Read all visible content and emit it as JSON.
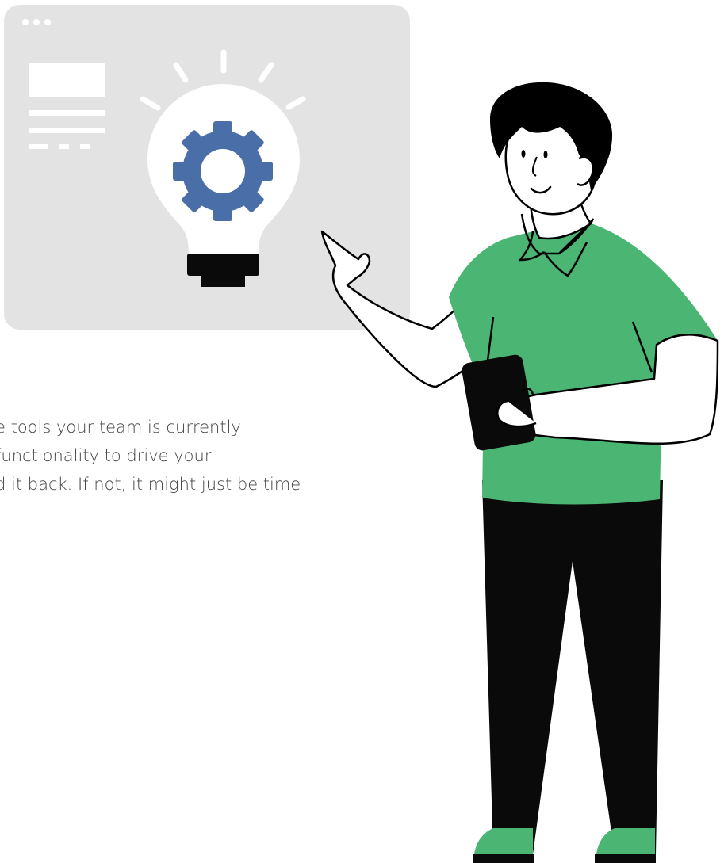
{
  "paragraph": {
    "lines": [
      "e tools your team is currently",
      "functionality to drive your",
      "d it back. If not, it might just be time"
    ]
  },
  "colors": {
    "panel": "#e3e3e3",
    "gear": "#4a6ea8",
    "bulb": "#ffffff",
    "shirt": "#4bb573",
    "pants": "#0a0a0a",
    "ink": "#000000",
    "text": "#444444"
  },
  "icons": {
    "window_dots": "three-dots-icon",
    "bulb": "lightbulb-icon",
    "gear": "gear-icon",
    "tablet": "tablet-icon"
  }
}
